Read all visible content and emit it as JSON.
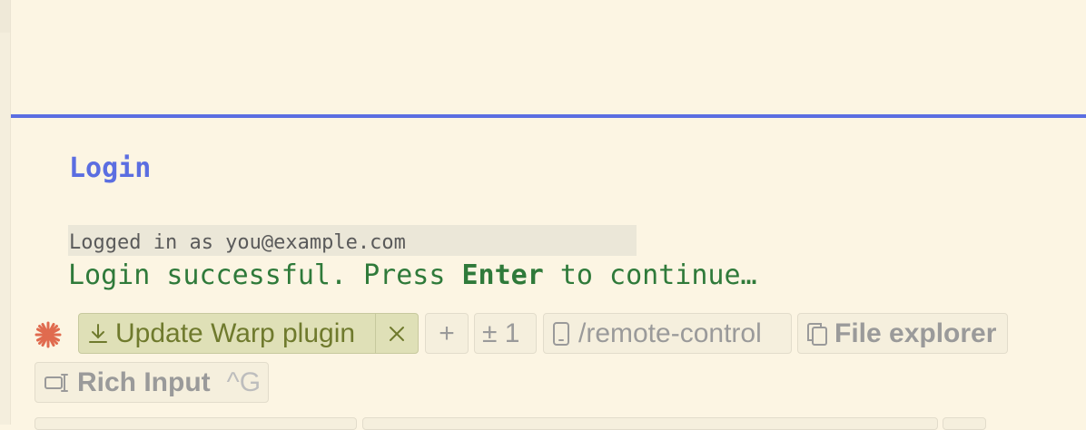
{
  "colors": {
    "accent": "#5b6ee1",
    "success": "#2f7a3a",
    "background": "#fcf5e3",
    "update_chip": "#dfe0b7",
    "spark": "#e06b4f"
  },
  "terminal": {
    "section_title": "Login",
    "logged_in_text": "Logged in as you@example.com",
    "success_before": "Login successful. Press ",
    "success_key": "Enter",
    "success_after": " to continue…"
  },
  "toolbar": {
    "update_label": "Update Warp plugin",
    "update_icon": "download-icon",
    "close_icon": "close-icon",
    "plus_label": "+",
    "diff_label": "± 1",
    "remote_label": "/remote-control",
    "remote_icon": "phone-icon",
    "files_label": "File explorer",
    "files_icon": "copy-files-icon",
    "rich_label": "Rich Input",
    "rich_shortcut": "^G",
    "rich_icon": "rich-input-icon"
  }
}
